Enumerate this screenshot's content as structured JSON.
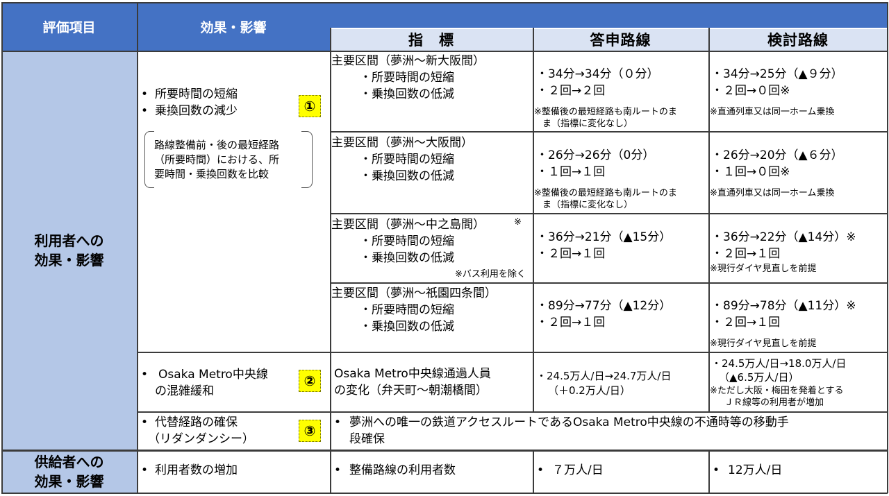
{
  "header": {
    "col_item": "評価項目",
    "col_effect": "効果・影響",
    "col_indicator": "指　標",
    "col_toushin": "答申路線",
    "col_kentou": "検討路線"
  },
  "sections": {
    "users_label": "利用者への\n効果・影響",
    "suppliers_label": "供給者への\n効果・影響"
  },
  "effect1": {
    "bullets": [
      "所要時間の短縮",
      "乗換回数の減少"
    ],
    "badge": "①",
    "note_lines": [
      "路線整備前・後の最短経路",
      "（所要時間）における、所",
      "要時間・乗換回数を比較"
    ]
  },
  "rows": [
    {
      "title": "主要区間（夢洲～新大阪間）",
      "title_mark": "",
      "sub": [
        "・所要時間の短縮",
        "・乗換回数の低減"
      ],
      "sub_note": "",
      "toushin": [
        "・34分→34分（０分）",
        "・２回→２回"
      ],
      "toushin_note": [
        "※整備後の最短経路も南ルートのま",
        "ま（指標に変化なし）"
      ],
      "kentou": [
        "・34分→25分（▲９分）",
        "・２回→０回※"
      ],
      "kentou_note": [
        "※直通列車又は同一ホーム乗換"
      ]
    },
    {
      "title": "主要区間（夢洲～大阪間）",
      "title_mark": "",
      "sub": [
        "・所要時間の短縮",
        "・乗換回数の低減"
      ],
      "sub_note": "",
      "toushin": [
        "・26分→26分（0分）",
        "・１回→１回"
      ],
      "toushin_note": [
        "※整備後の最短経路も南ルートのま",
        "ま（指標に変化なし）"
      ],
      "kentou": [
        "・26分→20分（▲６分）",
        "・１回→０回※"
      ],
      "kentou_note": [
        "※直通列車又は同一ホーム乗換"
      ]
    },
    {
      "title": "主要区間（夢洲～中之島間）",
      "title_mark": "※",
      "sub": [
        "・所要時間の短縮",
        "・乗換回数の低減"
      ],
      "sub_note": "※バス利用を除く",
      "toushin": [
        "・36分→21分（▲15分）",
        "・２回→１回"
      ],
      "toushin_note": [],
      "kentou": [
        "・36分→22分（▲14分）※",
        "・２回→１回"
      ],
      "kentou_note": [
        "※現行ダイヤ見直しを前提"
      ]
    },
    {
      "title": "主要区間（夢洲～祇園四条間）",
      "title_mark": "",
      "sub": [
        "・所要時間の短縮",
        "・乗換回数の低減"
      ],
      "sub_note": "",
      "toushin": [
        "・89分→77分（▲12分）",
        "・２回→１回"
      ],
      "toushin_note": [],
      "kentou": [
        "・89分→78分（▲11分）※",
        "・２回→１回"
      ],
      "kentou_note": [
        "※現行ダイヤ見直しを前提"
      ]
    }
  ],
  "effect2": {
    "lines": [
      "Osaka Metro中央線",
      "の混雑緩和"
    ],
    "badge": "②",
    "indicator": [
      "Osaka Metro中央線通過人員",
      "の変化（弁天町～朝潮橋間）"
    ],
    "toushin": [
      "・24.5万人/日→24.7万人/日",
      "（＋0.2万人/日）"
    ],
    "kentou": [
      "・24.5万人/日→18.0万人/日",
      "（▲6.5万人/日）"
    ],
    "kentou_note": [
      "※ただし大阪・梅田を発着とする",
      "ＪＲ線等の利用者が増加"
    ]
  },
  "effect3": {
    "lines": [
      "代替経路の確保",
      "（リダンダンシー）"
    ],
    "badge": "③",
    "desc": [
      "夢洲への唯一の鉄道アクセスルートであるOsaka Metro中央線の不通時等の移動手",
      "段確保"
    ]
  },
  "supplier": {
    "effect": "利用者数の増加",
    "indicator": "整備路線の利用者数",
    "toushin": "７万人/日",
    "kentou": "12万人/日"
  },
  "bullet_char": "•"
}
